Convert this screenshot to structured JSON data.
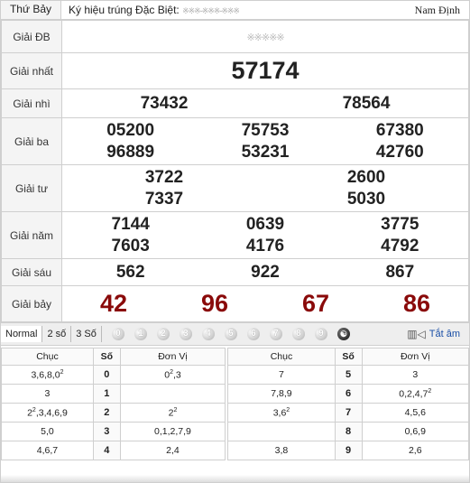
{
  "header": {
    "day": "Thứ Bảy",
    "special_symbol_label": "Ký hiệu trúng Đặc Biệt:",
    "special_symbol_value": "※※※-※※※-※※※",
    "province": "Nam Định"
  },
  "prizes": {
    "db": {
      "label": "Giải ĐB",
      "value": "※※※※※"
    },
    "nhat": {
      "label": "Giải nhất",
      "values": [
        "57174"
      ]
    },
    "nhi": {
      "label": "Giải nhì",
      "values": [
        "73432",
        "78564"
      ]
    },
    "ba": {
      "label": "Giải ba",
      "values": [
        "05200",
        "75753",
        "67380",
        "96889",
        "53231",
        "42760"
      ]
    },
    "tu": {
      "label": "Giải tư",
      "values": [
        "3722",
        "2600",
        "7337",
        "5030"
      ]
    },
    "nam": {
      "label": "Giải năm",
      "values": [
        "7144",
        "0639",
        "3775",
        "7603",
        "4176",
        "4792"
      ]
    },
    "sau": {
      "label": "Giải sáu",
      "values": [
        "562",
        "922",
        "867"
      ]
    },
    "bay": {
      "label": "Giải bảy",
      "values": [
        "42",
        "96",
        "67",
        "86"
      ]
    }
  },
  "controls": {
    "options": [
      "Normal",
      "2 số",
      "3 Số"
    ],
    "digits": [
      "0",
      "1",
      "2",
      "3",
      "4",
      "5",
      "6",
      "7",
      "8",
      "9"
    ],
    "all_icon": "yin-yang-icon",
    "toggle_label": "Tắt âm"
  },
  "loto": {
    "headers": {
      "chuc": "Chục",
      "so": "Số",
      "donvi": "Đơn Vị"
    },
    "left": [
      {
        "chuc": "3,6,8,0",
        "chuc_sup": "2",
        "so": "0",
        "donvi": "0",
        "donvi_sup": "2",
        "donvi_tail": ",3"
      },
      {
        "chuc": "3",
        "chuc_sup": "",
        "so": "1",
        "donvi": "",
        "donvi_sup": "",
        "donvi_tail": ""
      },
      {
        "chuc": "2",
        "chuc_sup": "2",
        "chuc_tail": ",3,4,6,9",
        "so": "2",
        "donvi": "2",
        "donvi_sup": "2",
        "donvi_tail": ""
      },
      {
        "chuc": "5,0",
        "chuc_sup": "",
        "so": "3",
        "donvi": "0,1,2,7,9",
        "donvi_sup": "",
        "donvi_tail": ""
      },
      {
        "chuc": "4,6,7",
        "chuc_sup": "",
        "so": "4",
        "donvi": "2,4",
        "donvi_sup": "",
        "donvi_tail": ""
      }
    ],
    "right": [
      {
        "chuc": "7",
        "chuc_sup": "",
        "so": "5",
        "donvi": "3",
        "donvi_sup": ""
      },
      {
        "chuc": "7,8,9",
        "chuc_sup": "",
        "so": "6",
        "donvi": "0,2,4,7",
        "donvi_sup": "2"
      },
      {
        "chuc": "3,6",
        "chuc_sup": "2",
        "so": "7",
        "donvi": "4,5,6",
        "donvi_sup": ""
      },
      {
        "chuc": "",
        "chuc_sup": "",
        "so": "8",
        "donvi": "0,6,9",
        "donvi_sup": ""
      },
      {
        "chuc": "3,8",
        "chuc_sup": "",
        "so": "9",
        "donvi": "2,6",
        "donvi_sup": ""
      }
    ]
  }
}
